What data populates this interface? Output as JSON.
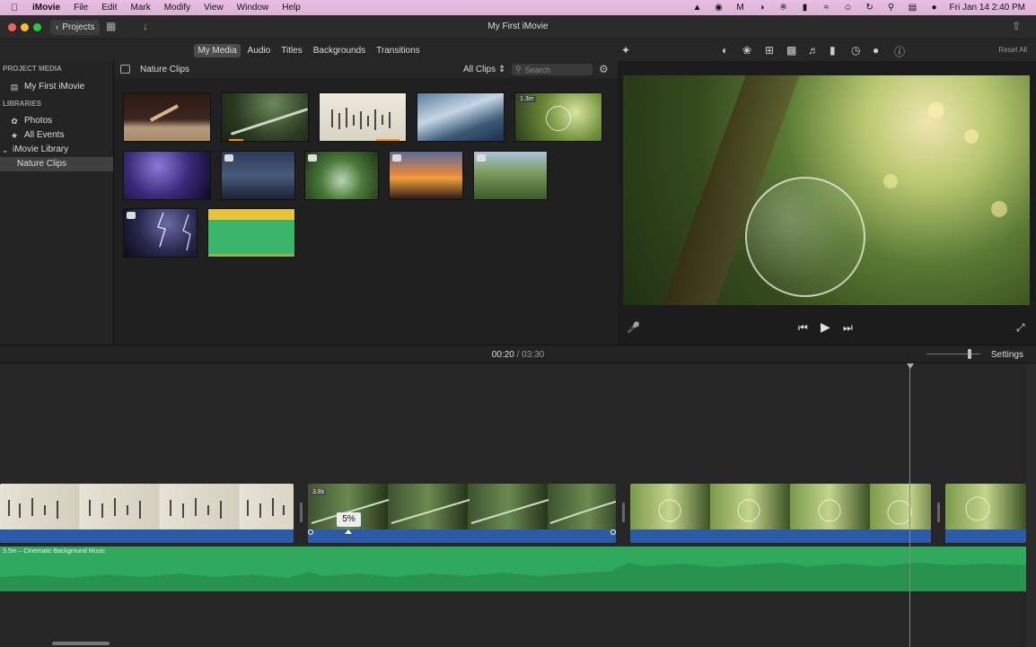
{
  "menubar": {
    "app": "iMovie",
    "items": [
      "File",
      "Edit",
      "Mark",
      "Modify",
      "View",
      "Window",
      "Help"
    ],
    "clock": "Fri Jan 14  2:40 PM"
  },
  "toolbar": {
    "projects_label": "Projects",
    "window_title": "My First iMovie"
  },
  "browser_tabs": [
    "My Media",
    "Audio",
    "Titles",
    "Backgrounds",
    "Transitions"
  ],
  "sidebar": {
    "project_media_header": "PROJECT MEDIA",
    "project_item": "My First iMovie",
    "libraries_header": "LIBRARIES",
    "photos": "Photos",
    "all_events": "All Events",
    "library": "iMovie Library",
    "event": "Nature Clips"
  },
  "browser": {
    "event_title": "Nature Clips",
    "filter": "All Clips",
    "search_placeholder": "Search",
    "clip5_duration": "1.3m"
  },
  "viewer": {
    "reset_all": "Reset All"
  },
  "timeline": {
    "current_time": "00:20",
    "separator": "/",
    "total_time": "03:30",
    "settings_label": "Settings",
    "clip2_duration": "3.8s",
    "speed_badge": "5%",
    "music_label": "3.5m – Cinematic Background Music"
  },
  "colors": {
    "accent": "#4b4b4b",
    "audio_bar": "#2c5aa8",
    "music_track": "#2faa5c"
  }
}
